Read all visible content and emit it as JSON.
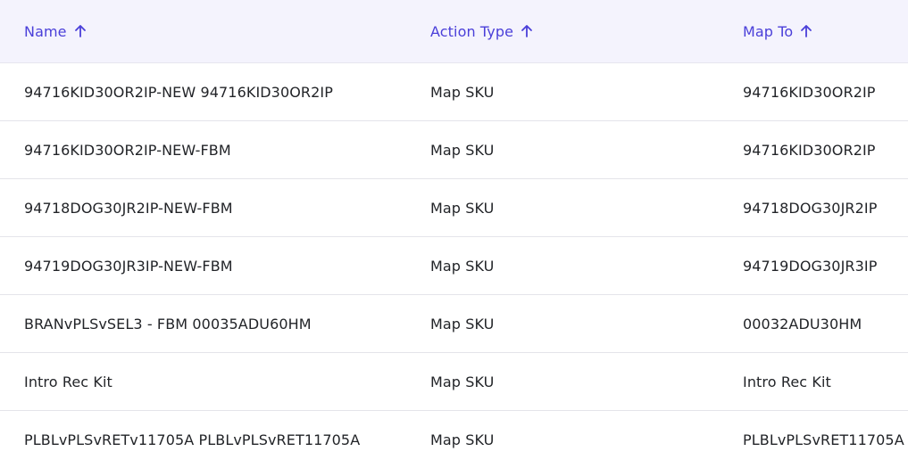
{
  "columns": {
    "name": "Name",
    "action_type": "Action Type",
    "map_to": "Map To"
  },
  "sort_icon": "arrow-up-icon",
  "colors": {
    "header_text": "#4a3fd9",
    "header_bg": "#f4f3fd",
    "row_text": "#222428",
    "divider": "#e4e4ea"
  },
  "rows": [
    {
      "name": "94716KID30OR2IP-NEW 94716KID30OR2IP",
      "action_type": "Map SKU",
      "map_to": "94716KID30OR2IP"
    },
    {
      "name": "94716KID30OR2IP-NEW-FBM",
      "action_type": "Map SKU",
      "map_to": "94716KID30OR2IP"
    },
    {
      "name": "94718DOG30JR2IP-NEW-FBM",
      "action_type": "Map SKU",
      "map_to": "94718DOG30JR2IP"
    },
    {
      "name": "94719DOG30JR3IP-NEW-FBM",
      "action_type": "Map SKU",
      "map_to": "94719DOG30JR3IP"
    },
    {
      "name": "BRANvPLSvSEL3 - FBM 00035ADU60HM",
      "action_type": "Map SKU",
      "map_to": "00032ADU30HM"
    },
    {
      "name": "Intro Rec Kit",
      "action_type": "Map SKU",
      "map_to": "Intro Rec Kit"
    },
    {
      "name": "PLBLvPLSvRETv11705A PLBLvPLSvRET11705A",
      "action_type": "Map SKU",
      "map_to": "PLBLvPLSvRET11705A"
    }
  ]
}
